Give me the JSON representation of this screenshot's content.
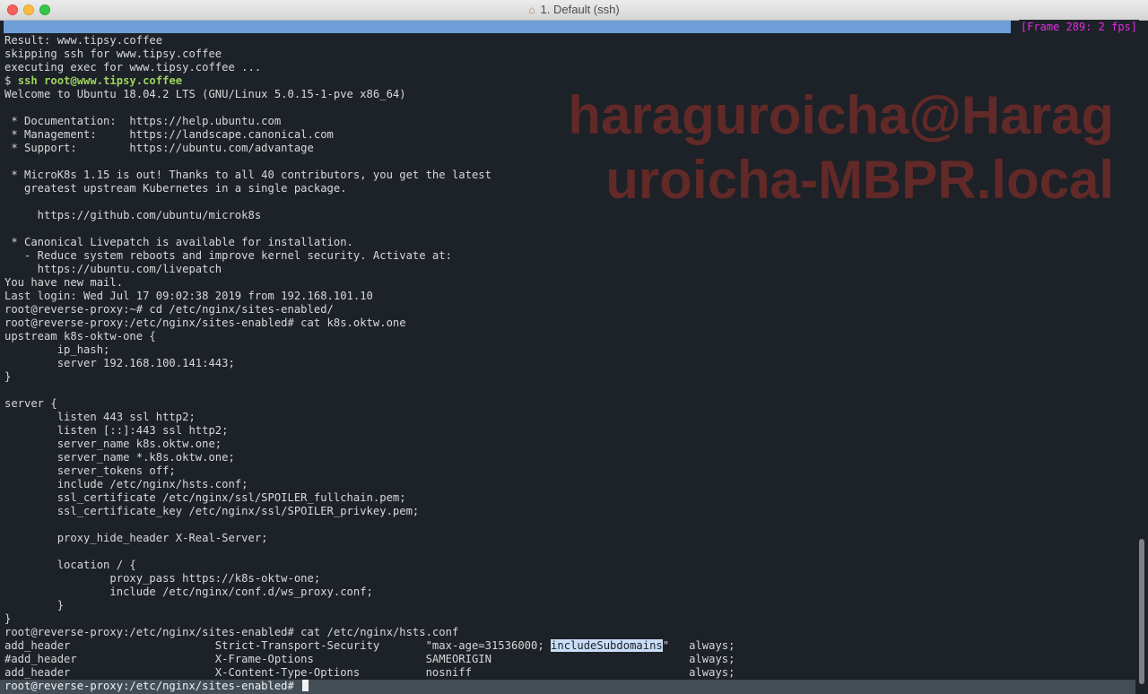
{
  "window": {
    "title": "1. Default (ssh)",
    "title_icon": "home-icon"
  },
  "status_bar": {
    "frame_label": "[Frame 289: 2 fps]",
    "progress_fraction": 0.887
  },
  "watermark": {
    "line1": "haraguroicha@Harag",
    "line2": "uroicha-MBPR.local"
  },
  "terminal": {
    "lines": [
      "Result: www.tipsy.coffee",
      "skipping ssh for www.tipsy.coffee",
      "executing exec for www.tipsy.coffee ...",
      "$ ssh root@www.tipsy.coffee",
      "Welcome to Ubuntu 18.04.2 LTS (GNU/Linux 5.0.15-1-pve x86_64)",
      "",
      " * Documentation:  https://help.ubuntu.com",
      " * Management:     https://landscape.canonical.com",
      " * Support:        https://ubuntu.com/advantage",
      "",
      " * MicroK8s 1.15 is out! Thanks to all 40 contributors, you get the latest",
      "   greatest upstream Kubernetes in a single package.",
      "",
      "     https://github.com/ubuntu/microk8s",
      "",
      " * Canonical Livepatch is available for installation.",
      "   - Reduce system reboots and improve kernel security. Activate at:",
      "     https://ubuntu.com/livepatch",
      "You have new mail.",
      "Last login: Wed Jul 17 09:02:38 2019 from 192.168.101.10",
      "root@reverse-proxy:~# cd /etc/nginx/sites-enabled/",
      "root@reverse-proxy:/etc/nginx/sites-enabled# cat k8s.oktw.one",
      "upstream k8s-oktw-one {",
      "        ip_hash;",
      "        server 192.168.100.141:443;",
      "}",
      "",
      "server {",
      "        listen 443 ssl http2;",
      "        listen [::]:443 ssl http2;",
      "        server_name k8s.oktw.one;",
      "        server_name *.k8s.oktw.one;",
      "        server_tokens off;",
      "        include /etc/nginx/hsts.conf;",
      "        ssl_certificate /etc/nginx/ssl/SPOILER_fullchain.pem;",
      "        ssl_certificate_key /etc/nginx/ssl/SPOILER_privkey.pem;",
      "",
      "        proxy_hide_header X-Real-Server;",
      "",
      "        location / {",
      "                proxy_pass https://k8s-oktw-one;",
      "                include /etc/nginx/conf.d/ws_proxy.conf;",
      "        }",
      "}",
      "root@reverse-proxy:/etc/nginx/sites-enabled# cat /etc/nginx/hsts.conf",
      {
        "before": "add_header                      Strict-Transport-Security       \"max-age=31536000; ",
        "highlight": "includeSubdomains",
        "after": "\"   always;"
      },
      "#add_header                     X-Frame-Options                 SAMEORIGIN                              always;",
      "add_header                      X-Content-Type-Options          nosniff                                 always;"
    ],
    "ssh_prefix": "$ ",
    "ssh_command": "ssh root@www.tipsy.coffee",
    "prompt": "root@reverse-proxy:/etc/nginx/sites-enabled# "
  },
  "scrollbar": {
    "position_fraction": 0.98,
    "visible_fraction": 0.22
  }
}
